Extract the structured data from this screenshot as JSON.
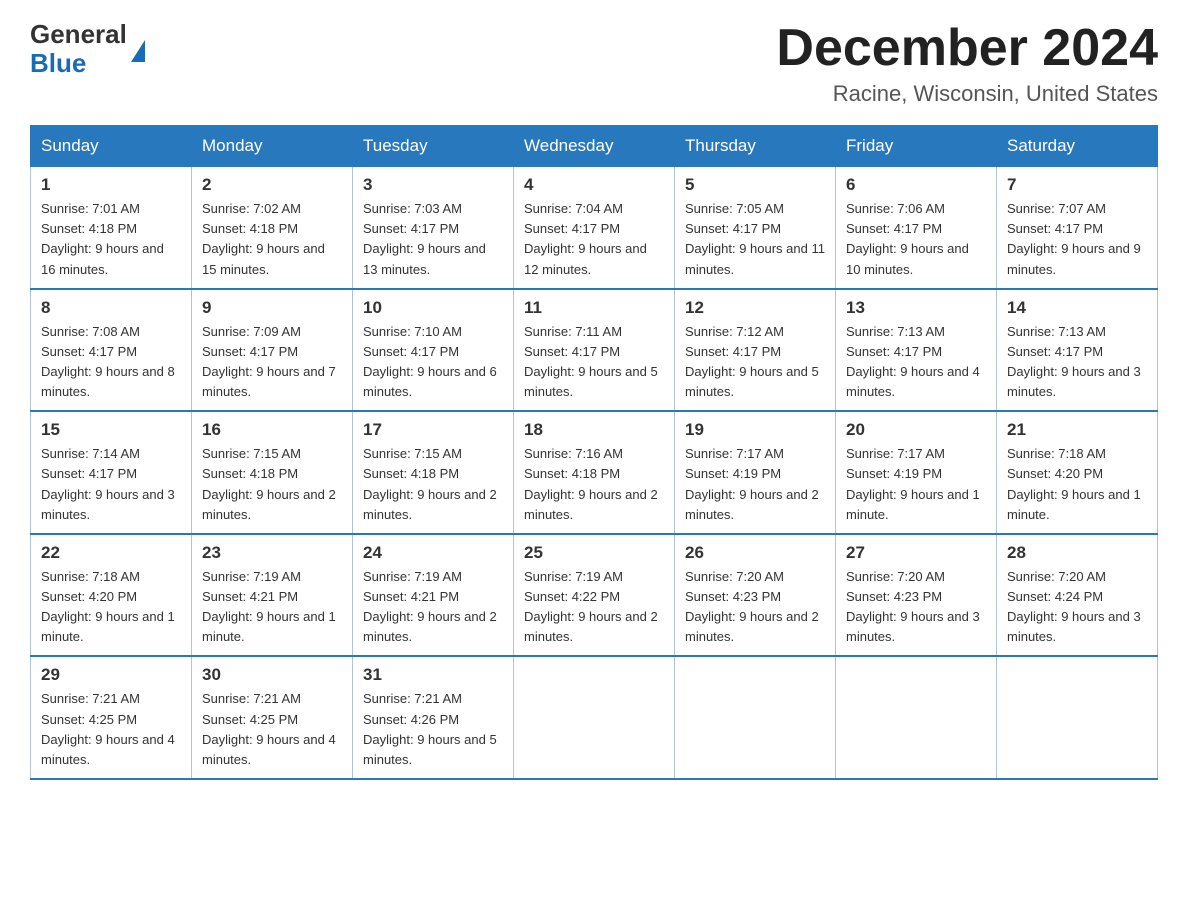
{
  "logo": {
    "general": "General",
    "blue": "Blue"
  },
  "title": "December 2024",
  "location": "Racine, Wisconsin, United States",
  "days_of_week": [
    "Sunday",
    "Monday",
    "Tuesday",
    "Wednesday",
    "Thursday",
    "Friday",
    "Saturday"
  ],
  "weeks": [
    [
      {
        "day": "1",
        "sunrise": "7:01 AM",
        "sunset": "4:18 PM",
        "daylight": "9 hours and 16 minutes."
      },
      {
        "day": "2",
        "sunrise": "7:02 AM",
        "sunset": "4:18 PM",
        "daylight": "9 hours and 15 minutes."
      },
      {
        "day": "3",
        "sunrise": "7:03 AM",
        "sunset": "4:17 PM",
        "daylight": "9 hours and 13 minutes."
      },
      {
        "day": "4",
        "sunrise": "7:04 AM",
        "sunset": "4:17 PM",
        "daylight": "9 hours and 12 minutes."
      },
      {
        "day": "5",
        "sunrise": "7:05 AM",
        "sunset": "4:17 PM",
        "daylight": "9 hours and 11 minutes."
      },
      {
        "day": "6",
        "sunrise": "7:06 AM",
        "sunset": "4:17 PM",
        "daylight": "9 hours and 10 minutes."
      },
      {
        "day": "7",
        "sunrise": "7:07 AM",
        "sunset": "4:17 PM",
        "daylight": "9 hours and 9 minutes."
      }
    ],
    [
      {
        "day": "8",
        "sunrise": "7:08 AM",
        "sunset": "4:17 PM",
        "daylight": "9 hours and 8 minutes."
      },
      {
        "day": "9",
        "sunrise": "7:09 AM",
        "sunset": "4:17 PM",
        "daylight": "9 hours and 7 minutes."
      },
      {
        "day": "10",
        "sunrise": "7:10 AM",
        "sunset": "4:17 PM",
        "daylight": "9 hours and 6 minutes."
      },
      {
        "day": "11",
        "sunrise": "7:11 AM",
        "sunset": "4:17 PM",
        "daylight": "9 hours and 5 minutes."
      },
      {
        "day": "12",
        "sunrise": "7:12 AM",
        "sunset": "4:17 PM",
        "daylight": "9 hours and 5 minutes."
      },
      {
        "day": "13",
        "sunrise": "7:13 AM",
        "sunset": "4:17 PM",
        "daylight": "9 hours and 4 minutes."
      },
      {
        "day": "14",
        "sunrise": "7:13 AM",
        "sunset": "4:17 PM",
        "daylight": "9 hours and 3 minutes."
      }
    ],
    [
      {
        "day": "15",
        "sunrise": "7:14 AM",
        "sunset": "4:17 PM",
        "daylight": "9 hours and 3 minutes."
      },
      {
        "day": "16",
        "sunrise": "7:15 AM",
        "sunset": "4:18 PM",
        "daylight": "9 hours and 2 minutes."
      },
      {
        "day": "17",
        "sunrise": "7:15 AM",
        "sunset": "4:18 PM",
        "daylight": "9 hours and 2 minutes."
      },
      {
        "day": "18",
        "sunrise": "7:16 AM",
        "sunset": "4:18 PM",
        "daylight": "9 hours and 2 minutes."
      },
      {
        "day": "19",
        "sunrise": "7:17 AM",
        "sunset": "4:19 PM",
        "daylight": "9 hours and 2 minutes."
      },
      {
        "day": "20",
        "sunrise": "7:17 AM",
        "sunset": "4:19 PM",
        "daylight": "9 hours and 1 minute."
      },
      {
        "day": "21",
        "sunrise": "7:18 AM",
        "sunset": "4:20 PM",
        "daylight": "9 hours and 1 minute."
      }
    ],
    [
      {
        "day": "22",
        "sunrise": "7:18 AM",
        "sunset": "4:20 PM",
        "daylight": "9 hours and 1 minute."
      },
      {
        "day": "23",
        "sunrise": "7:19 AM",
        "sunset": "4:21 PM",
        "daylight": "9 hours and 1 minute."
      },
      {
        "day": "24",
        "sunrise": "7:19 AM",
        "sunset": "4:21 PM",
        "daylight": "9 hours and 2 minutes."
      },
      {
        "day": "25",
        "sunrise": "7:19 AM",
        "sunset": "4:22 PM",
        "daylight": "9 hours and 2 minutes."
      },
      {
        "day": "26",
        "sunrise": "7:20 AM",
        "sunset": "4:23 PM",
        "daylight": "9 hours and 2 minutes."
      },
      {
        "day": "27",
        "sunrise": "7:20 AM",
        "sunset": "4:23 PM",
        "daylight": "9 hours and 3 minutes."
      },
      {
        "day": "28",
        "sunrise": "7:20 AM",
        "sunset": "4:24 PM",
        "daylight": "9 hours and 3 minutes."
      }
    ],
    [
      {
        "day": "29",
        "sunrise": "7:21 AM",
        "sunset": "4:25 PM",
        "daylight": "9 hours and 4 minutes."
      },
      {
        "day": "30",
        "sunrise": "7:21 AM",
        "sunset": "4:25 PM",
        "daylight": "9 hours and 4 minutes."
      },
      {
        "day": "31",
        "sunrise": "7:21 AM",
        "sunset": "4:26 PM",
        "daylight": "9 hours and 5 minutes."
      },
      null,
      null,
      null,
      null
    ]
  ]
}
